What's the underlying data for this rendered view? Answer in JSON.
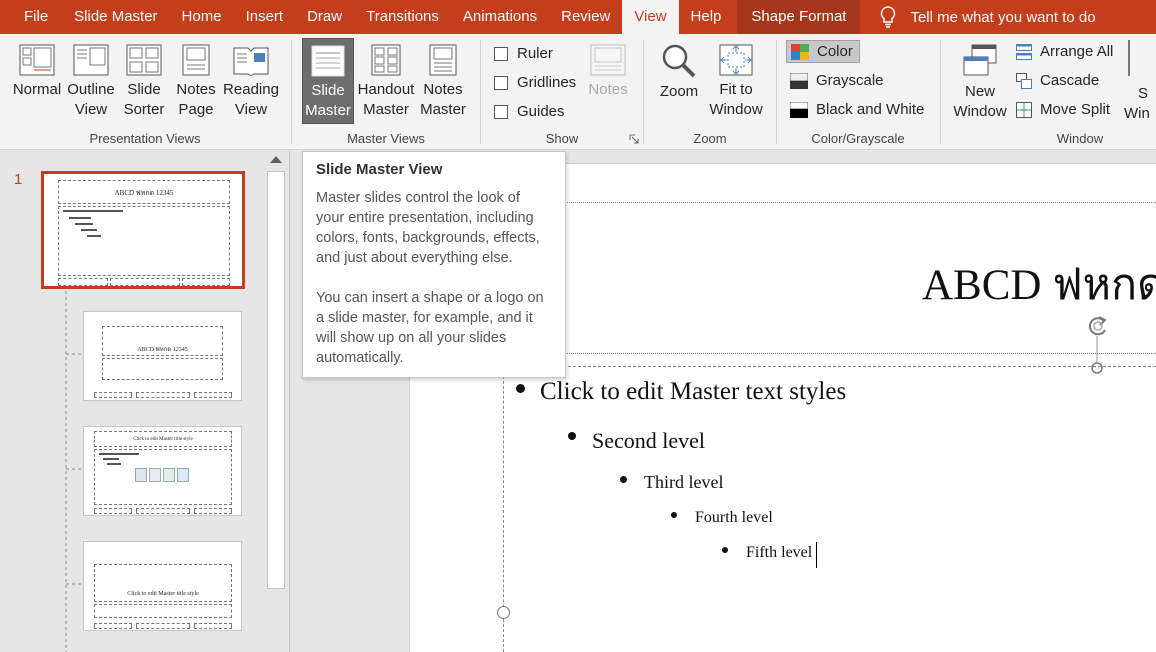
{
  "menu": {
    "file": "File",
    "tabs": [
      "Slide Master",
      "Home",
      "Insert",
      "Draw",
      "Transitions",
      "Animations",
      "Review"
    ],
    "active": "View",
    "after": [
      "Help"
    ],
    "shape_format": "Shape Format",
    "tell_me": "Tell me what you want to do"
  },
  "ribbon": {
    "presentation_views": {
      "label": "Presentation Views",
      "normal": [
        "Normal",
        ""
      ],
      "outline": [
        "Outline",
        "View"
      ],
      "sorter": [
        "Slide",
        "Sorter"
      ],
      "notes_page": [
        "Notes",
        "Page"
      ],
      "reading": [
        "Reading",
        "View"
      ]
    },
    "master_views": {
      "label": "Master Views",
      "slide_master": [
        "Slide",
        "Master"
      ],
      "handout_master": [
        "Handout",
        "Master"
      ],
      "notes_master": [
        "Notes",
        "Master"
      ]
    },
    "show": {
      "label": "Show",
      "ruler": "Ruler",
      "gridlines": "Gridlines",
      "guides": "Guides",
      "notes": "Notes"
    },
    "zoom": {
      "label": "Zoom",
      "zoom": "Zoom",
      "fit": [
        "Fit to",
        "Window"
      ]
    },
    "color": {
      "label": "Color/Grayscale",
      "color": "Color",
      "grayscale": "Grayscale",
      "bw": "Black and White"
    },
    "window": {
      "label": "Window",
      "new_window": [
        "New",
        "Window"
      ],
      "arrange_all": "Arrange All",
      "cascade": "Cascade",
      "move_split": "Move Split",
      "switch_partial": [
        "S",
        "Win"
      ]
    }
  },
  "thumbnails": {
    "slide_number": "1",
    "thumb1_title": "ABCD ฟหกด 12345",
    "thumb2_title": "ABCD ฟหกด 12345",
    "thumb3_title": "Click to edit Master title style",
    "thumb4_title": "Click to edit Master title style"
  },
  "tooltip": {
    "title": "Slide Master View",
    "para1": "Master slides control the look of your entire presentation, including colors, fonts, backgrounds, effects, and just about everything else.",
    "para2": "You can insert a shape or a logo on a slide master, for example, and it will show up on all your slides automatically."
  },
  "slide": {
    "title": "ABCD ฟหกด",
    "levels": [
      "Click to edit Master text styles",
      "Second level",
      "Third level",
      "Fourth level",
      "Fifth level"
    ]
  },
  "colors": {
    "accent": "#c43e1c",
    "ribbon_bg": "#f3f3f3"
  }
}
